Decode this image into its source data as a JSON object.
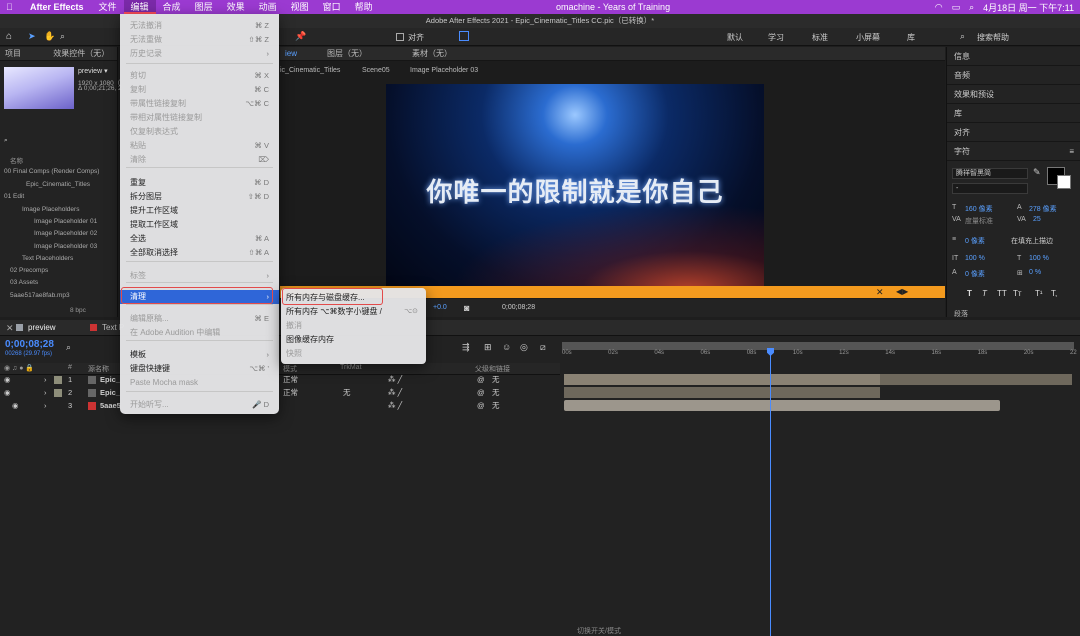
{
  "menubar": {
    "app_name": "After Effects",
    "items": [
      "文件",
      "编辑",
      "合成",
      "图层",
      "效果",
      "动画",
      "视图",
      "窗口",
      "帮助"
    ],
    "now_playing": "omachine - Years of Training",
    "datetime": "4月18日 周一 下午7:11"
  },
  "window_title": "Adobe After Effects 2021 - Epic_Cinematic_Titles CC.pic（已转换）*",
  "toolbar": {
    "snap_label": "对齐",
    "workspaces": [
      "默认",
      "学习",
      "标准",
      "小屏幕",
      "库"
    ],
    "search_placeholder": "搜索帮助"
  },
  "project_panel": {
    "tabs": [
      "项目",
      "效果控件（无）"
    ],
    "thumb_title": "preview ▾",
    "thumb_info1": "1920 x 1080（",
    "thumb_info2": "Δ 0;00;21;26, 2",
    "column_name": "名称",
    "tree": [
      "00 Final Comps (Render Comps)",
      "Epic_Cinematic_Titles",
      "01 Edit",
      "Image Placeholders",
      "Image Placeholder 01",
      "Image Placeholder 02",
      "Image Placeholder 03",
      "Text Placeholders",
      "02 Precomps",
      "03 Assets",
      "5aae517ae8fab.mp3"
    ],
    "bpc": "8 bpc"
  },
  "viewer": {
    "tabs": [
      "iew",
      "图层（无）",
      "素材（无）"
    ],
    "breadcrumbs": [
      "ic_Cinematic_Titles",
      "Scene05",
      "Image Placeholder 03"
    ],
    "caption": "你唯一的限制就是你自己",
    "exposure": "+0.0",
    "timecode": "0;00;08;28"
  },
  "right_panels": {
    "items": [
      "信息",
      "音频",
      "效果和预设",
      "库",
      "对齐"
    ],
    "character_title": "字符",
    "font_name": "腾祥智黑简",
    "font_style": "-",
    "size": "160 像素",
    "leading": "278 像素",
    "kerning": "度量标准",
    "tracking": "25",
    "stroke": "0 像素",
    "stroke_mode": "在填充上描边",
    "vscale": "100 %",
    "hscale": "100 %",
    "baseline": "0 像素",
    "tsume": "0 %",
    "style_buttons": [
      "T",
      "T",
      "TT",
      "Tт",
      "T¹",
      "T,"
    ],
    "para_label": "段落"
  },
  "timeline": {
    "tabs": [
      "preview",
      "Text P"
    ],
    "timecode": "0;00;08;28",
    "frames": "00268 (29.97 fps)",
    "headers": [
      "#",
      "源名称",
      "模式",
      "TrkMat",
      "父级和链接"
    ],
    "ruler": [
      "00s",
      "02s",
      "04s",
      "06s",
      "08s",
      "10s",
      "12s",
      "14s",
      "16s",
      "18s",
      "20s",
      "22"
    ],
    "layers": [
      {
        "num": "1",
        "name": "Epic_",
        "mode": "正常",
        "trk": "",
        "parent": "无"
      },
      {
        "num": "2",
        "name": "Epic_",
        "mode": "正常",
        "trk": "无",
        "parent": "无"
      },
      {
        "num": "3",
        "name": "5aae5",
        "mode": "",
        "trk": "",
        "parent": "无"
      }
    ],
    "bottom_label": "切换开关/模式"
  },
  "edit_menu": {
    "items": [
      {
        "label": "无法撤消",
        "shortcut": "⌘ Z",
        "disabled": true
      },
      {
        "label": "无法重做",
        "shortcut": "⇧⌘ Z",
        "disabled": true
      },
      {
        "label": "历史记录",
        "shortcut": "›",
        "disabled": true
      },
      {
        "label": "剪切",
        "shortcut": "⌘ X",
        "disabled": true
      },
      {
        "label": "复制",
        "shortcut": "⌘ C",
        "disabled": true
      },
      {
        "label": "带属性链接复制",
        "shortcut": "⌥⌘ C",
        "disabled": true
      },
      {
        "label": "带相对属性链接复制",
        "shortcut": "",
        "disabled": true
      },
      {
        "label": "仅复制表达式",
        "shortcut": "",
        "disabled": true
      },
      {
        "label": "粘贴",
        "shortcut": "⌘ V",
        "disabled": true
      },
      {
        "label": "清除",
        "shortcut": "⌦",
        "disabled": true
      },
      {
        "label": "重复",
        "shortcut": "⌘ D",
        "disabled": false
      },
      {
        "label": "拆分图层",
        "shortcut": "⇧⌘ D",
        "disabled": false
      },
      {
        "label": "提升工作区域",
        "shortcut": "",
        "disabled": false
      },
      {
        "label": "提取工作区域",
        "shortcut": "",
        "disabled": false
      },
      {
        "label": "全选",
        "shortcut": "⌘ A",
        "disabled": false
      },
      {
        "label": "全部取消选择",
        "shortcut": "⇧⌘ A",
        "disabled": false
      },
      {
        "label": "标签",
        "shortcut": "›",
        "disabled": true
      },
      {
        "label": "清理",
        "shortcut": "›",
        "disabled": false,
        "highlight": true
      },
      {
        "label": "编辑原稿...",
        "shortcut": "⌘ E",
        "disabled": true
      },
      {
        "label": "在 Adobe Audition 中编辑",
        "shortcut": "",
        "disabled": true
      },
      {
        "label": "模板",
        "shortcut": "›",
        "disabled": false
      },
      {
        "label": "键盘快捷键",
        "shortcut": "⌥⌘ '",
        "disabled": false
      },
      {
        "label": "Paste Mocha mask",
        "shortcut": "",
        "disabled": true
      },
      {
        "label": "开始听写...",
        "shortcut": "🎤 D",
        "disabled": true
      }
    ]
  },
  "purge_submenu": {
    "items": [
      {
        "label": "所有内存与磁盘缓存...",
        "shortcut": "",
        "disabled": false
      },
      {
        "label": "所有内存 ⌥⌘数字小键盘 /",
        "shortcut": "⌥⊙",
        "disabled": false
      },
      {
        "label": "撤消",
        "shortcut": "",
        "disabled": true
      },
      {
        "label": "图像缓存内存",
        "shortcut": "",
        "disabled": false
      },
      {
        "label": "快照",
        "shortcut": "",
        "disabled": true
      }
    ]
  },
  "colors": {
    "menubar": "#9b3ad1",
    "highlight": "#2f66d8",
    "annotation": "#e24b4b",
    "timebar": "#f39a1e",
    "playhead": "#4a8cff"
  }
}
